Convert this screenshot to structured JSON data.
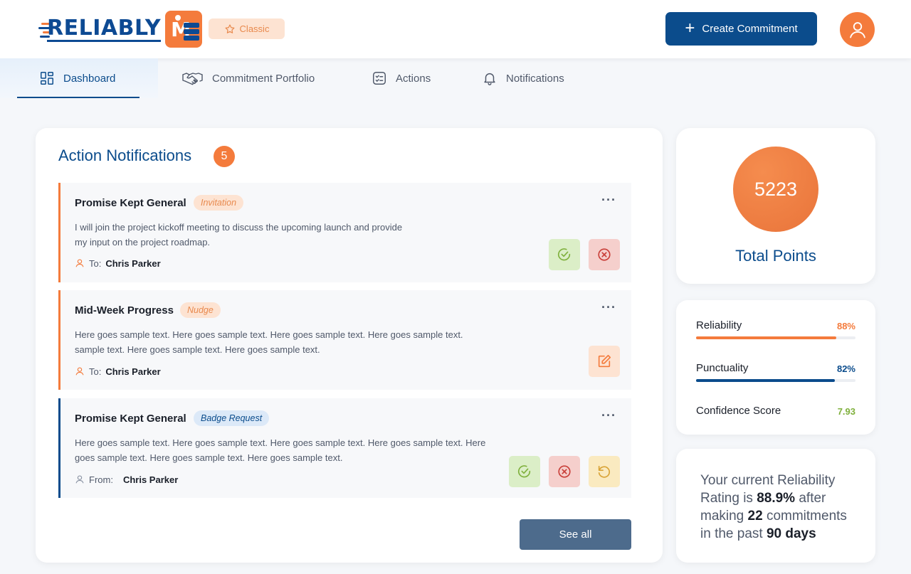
{
  "brand": {
    "name": "RELIABLY",
    "badge_letter": "M",
    "tier_label": "Classic"
  },
  "header": {
    "create_label": "Create Commitment"
  },
  "nav": {
    "tabs": [
      {
        "label": "Dashboard",
        "icon": "grid-icon"
      },
      {
        "label": "Commitment Portfolio",
        "icon": "handshake-icon"
      },
      {
        "label": "Actions",
        "icon": "checklist-icon"
      },
      {
        "label": "Notifications",
        "icon": "bell-icon"
      }
    ],
    "active": "Dashboard"
  },
  "notifications": {
    "title": "Action Notifications",
    "count": "5",
    "items": [
      {
        "title": "Promise Kept General",
        "tag": "Invitation",
        "line1": "I will join the project kickoff meeting to discuss the upcoming launch and provide",
        "line2": "my input on the project roadmap.",
        "person_label": "To:",
        "person": "Chris Parker"
      },
      {
        "title": "Mid-Week Progress",
        "tag": "Nudge",
        "line1": "Here goes sample text. Here goes sample text. Here goes sample text. Here goes sample text.",
        "line2": "sample text. Here goes sample text. Here goes sample text.",
        "person_label": "To:",
        "person": "Chris Parker"
      },
      {
        "title": "Promise Kept General",
        "tag": "Badge Request",
        "line1": "Here goes sample text. Here goes sample text. Here goes sample text. Here goes sample text. Here",
        "line2": "goes sample text. Here goes sample text. Here goes sample text.",
        "person_label": "From:",
        "person": "Chris Parker"
      }
    ],
    "see_all": "See all"
  },
  "points": {
    "value": "5223",
    "label": "Total Points"
  },
  "stats": {
    "reliability": {
      "label": "Reliability",
      "value": "88%",
      "fraction": 0.88
    },
    "punctuality": {
      "label": "Punctuality",
      "value": "82%",
      "fraction": 0.82
    },
    "confidence": {
      "label": "Confidence Score",
      "value": "7.93"
    }
  },
  "summary": {
    "p1": "Your current Reliability Rating is ",
    "rating": "88.9%",
    "p2": " after making ",
    "commitments": "22",
    "p3": " commitments in the past ",
    "days": "90 days"
  },
  "colors": {
    "primary": "#0b4c8c",
    "accent": "#f47b3c",
    "success": "#7fb03c",
    "danger": "#c9403a",
    "warning": "#d9a437"
  }
}
